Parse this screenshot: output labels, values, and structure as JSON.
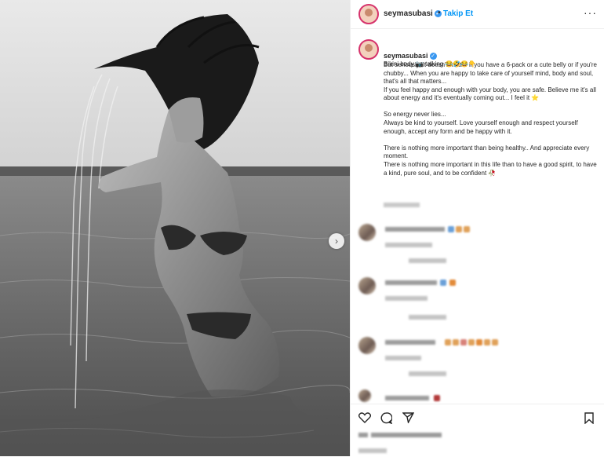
{
  "post": {
    "username": "seymasubasi",
    "follow_label": "Takip Et",
    "more_icon": "more-horizontal-icon",
    "caption_lines": [
      "Bikini body 📷 talking 😂🤣😂👇",
      "But seriously, It doesn't matter if you have a 6-pack or a cute belly or if you're chubby... When you are happy to take care of yourself mind, body and soul, that's all that matters...\nIf you feel happy and enough with your body, you are safe. Believe me it's all about energy and it's eventually coming out... I feel it ⭐",
      "So energy never lies...\nAlways be kind to yourself. Love yourself enough and respect yourself enough, accept any form and be happy with it.",
      "There is nothing more important than being healthy.. And appreciate every moment.\nThere is nothing more important in this life than to have a good spirit, to have a kind, pure soul, and to be confident 🥀"
    ]
  },
  "colors": {
    "accent": "#0095f6",
    "verified": "#3897f0",
    "story_ring": "#d6336c",
    "text": "#262626"
  },
  "icons": [
    "heart-icon",
    "comment-icon",
    "share-icon",
    "bookmark-icon",
    "chevron-right-icon",
    "verified-icon"
  ]
}
